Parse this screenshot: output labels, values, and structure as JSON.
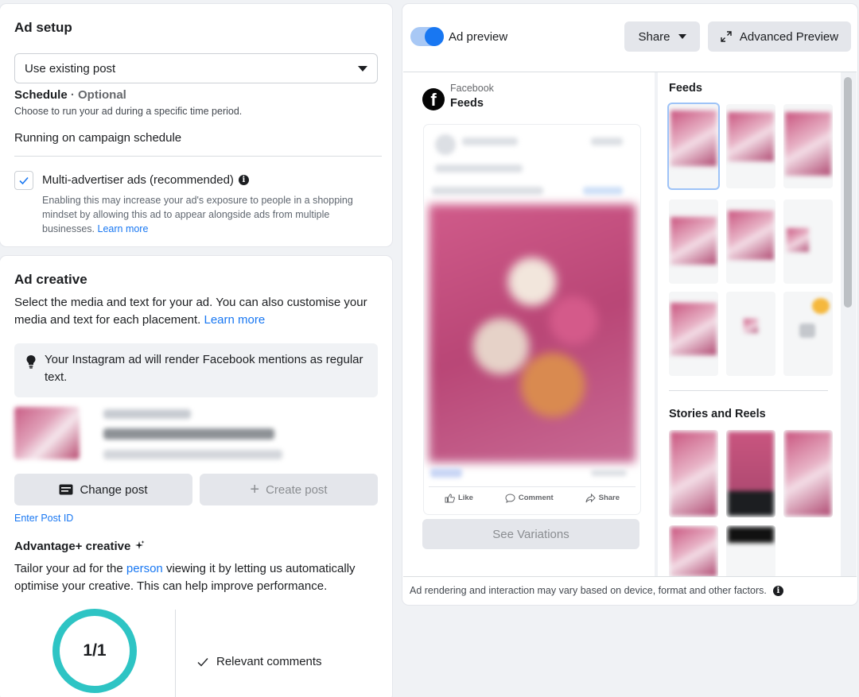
{
  "ad_setup": {
    "title": "Ad setup",
    "post_select": "Use existing post",
    "schedule_title": "Schedule",
    "schedule_optional": " · Optional",
    "schedule_desc": "Choose to run your ad during a specific time period.",
    "schedule_value": "Running on campaign schedule",
    "multi_advertiser_label": "Multi-advertiser ads (recommended)",
    "multi_advertiser_checked": true,
    "multi_advertiser_desc": "Enabling this may increase your ad's exposure to people in a shopping mindset by allowing this ad to appear alongside ads from multiple businesses.",
    "learn_more": "Learn more"
  },
  "ad_creative": {
    "title": "Ad creative",
    "desc": "Select the media and text for your ad. You can also customise your media and text for each placement.",
    "learn_more": "Learn more",
    "ig_note": "Your Instagram ad will render Facebook mentions as regular text.",
    "change_post": "Change post",
    "create_post": "Create post",
    "enter_post_id": "Enter Post ID",
    "advantage_title": "Advantage+ creative",
    "advantage_desc_1": "Tailor your ad for the ",
    "advantage_link": "person",
    "advantage_desc_2": " viewing it by letting us automatically optimise your creative. This can help improve performance.",
    "progress": "1/1",
    "relevant_comments": "Relevant comments"
  },
  "preview": {
    "toggle_label": "Ad preview",
    "toggle_on": true,
    "share": "Share",
    "advanced_preview": "Advanced Preview",
    "platform": "Facebook",
    "placement": "Feeds",
    "actions": [
      "Like",
      "Comment",
      "Share"
    ],
    "see_variations": "See Variations",
    "feeds_label": "Feeds",
    "stories_label": "Stories and Reels",
    "footer": "Ad rendering and interaction may vary based on device, format and other factors."
  },
  "colors": {
    "accent": "#1877f2",
    "ring": "#2ec4c4"
  }
}
